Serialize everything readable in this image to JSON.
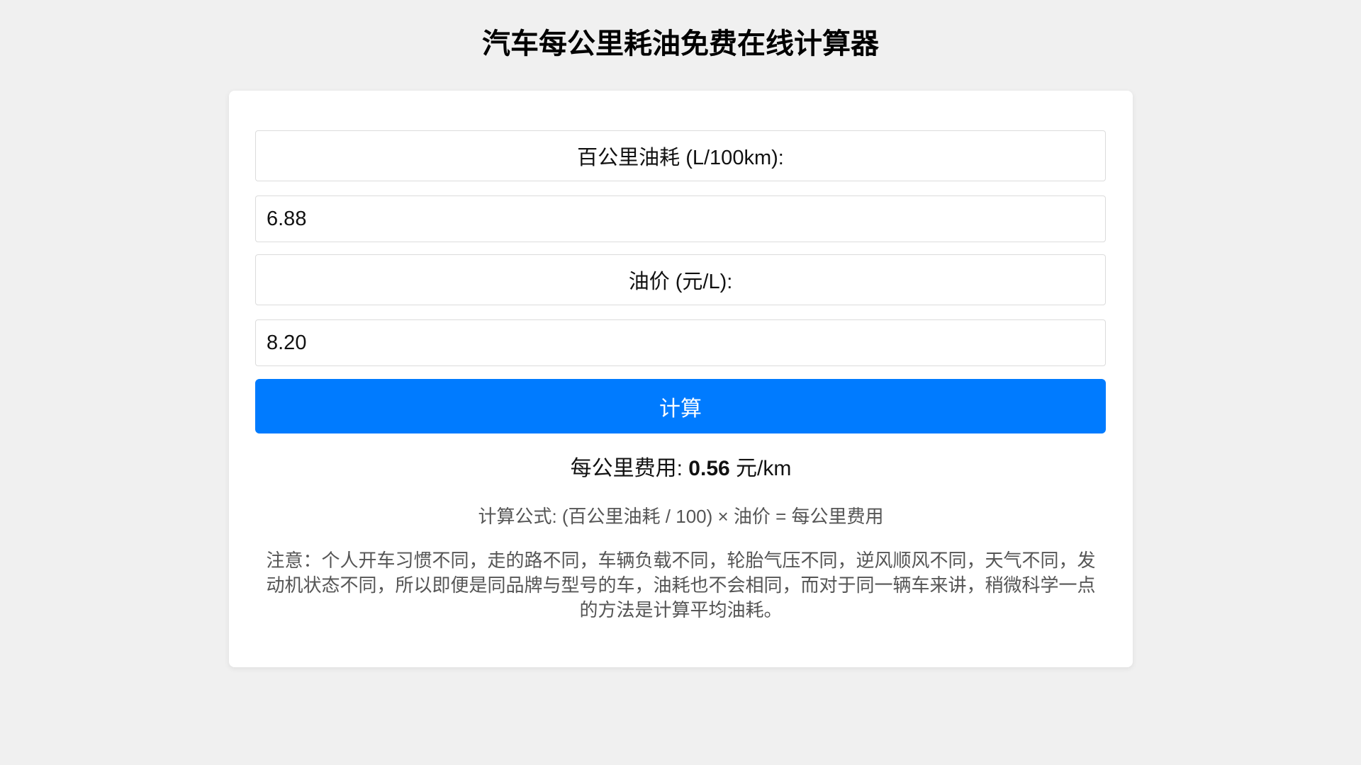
{
  "header": {
    "title": "汽车每公里耗油免费在线计算器"
  },
  "form": {
    "consumption_label": "百公里油耗 (L/100km):",
    "consumption_value": "6.88",
    "price_label": "油价 (元/L):",
    "price_value": "8.20",
    "calculate_label": "计算"
  },
  "result": {
    "prefix": "每公里费用: ",
    "value": "0.56",
    "unit": " 元/km"
  },
  "info": {
    "formula": "计算公式: (百公里油耗 / 100) × 油价 = 每公里费用",
    "note": "注意：个人开车习惯不同，走的路不同，车辆负载不同，轮胎气压不同，逆风顺风不同，天气不同，发动机状态不同，所以即便是同品牌与型号的车，油耗也不会相同，而对于同一辆车来讲，稍微科学一点的方法是计算平均油耗。"
  },
  "colors": {
    "accent": "#007bff",
    "background": "#f0f0f0",
    "card": "#ffffff"
  }
}
